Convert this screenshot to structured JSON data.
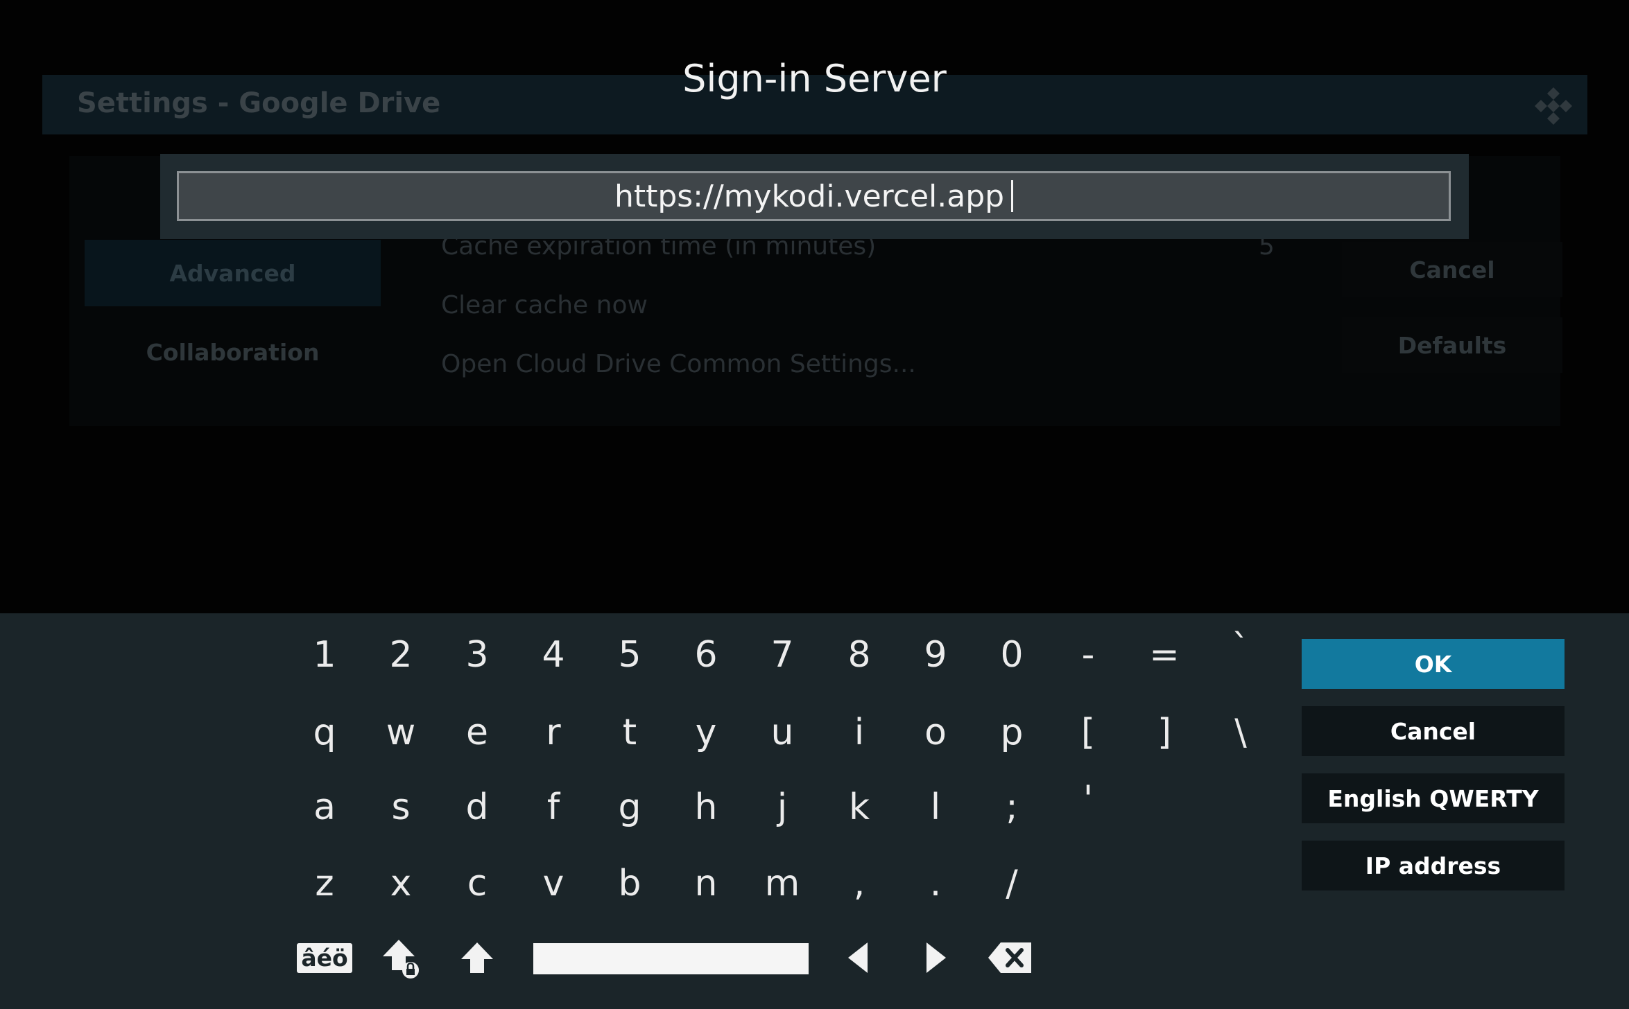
{
  "background_window": {
    "title": "Settings - Google Drive",
    "categories": [
      {
        "label": "Advanced",
        "selected": true
      },
      {
        "label": "Collaboration",
        "selected": false
      }
    ],
    "settings": [
      {
        "label": "Cache expiration time (in minutes)",
        "value": "5"
      },
      {
        "label": "Clear cache now",
        "value": ""
      },
      {
        "label": "Open Cloud Drive Common Settings...",
        "value": ""
      }
    ],
    "side_buttons": [
      {
        "label": "Cancel"
      },
      {
        "label": "Defaults"
      }
    ]
  },
  "dialog": {
    "heading": "Sign-in Server",
    "input_value": "https://mykodi.vercel.app"
  },
  "keyboard": {
    "row1": [
      "1",
      "2",
      "3",
      "4",
      "5",
      "6",
      "7",
      "8",
      "9",
      "0",
      "-",
      "=",
      "`"
    ],
    "row2": [
      "q",
      "w",
      "e",
      "r",
      "t",
      "y",
      "u",
      "i",
      "o",
      "p",
      "[",
      "]",
      "\\"
    ],
    "row3": [
      "a",
      "s",
      "d",
      "f",
      "g",
      "h",
      "j",
      "k",
      "l",
      ";",
      "'"
    ],
    "row4": [
      "z",
      "x",
      "c",
      "v",
      "b",
      "n",
      "m",
      ",",
      ".",
      "/"
    ],
    "accents_label": "âéö",
    "icons": [
      "caps-lock-icon",
      "shift-icon",
      "arrow-left-icon",
      "arrow-right-icon",
      "backspace-icon"
    ]
  },
  "buttons": {
    "ok": "OK",
    "cancel": "Cancel",
    "layout": "English QWERTY",
    "ip_address": "IP address"
  },
  "colors": {
    "keyboard_panel": "#1b2529",
    "ok_active": "#12799e",
    "button_bg": "#0e1518",
    "input_bg": "#3f4549"
  }
}
